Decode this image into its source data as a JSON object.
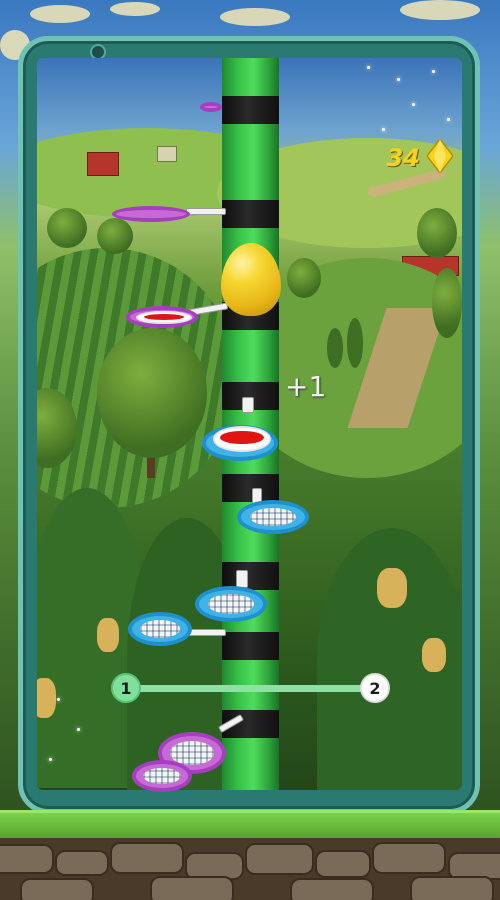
{
  "game": {
    "title": ""
  },
  "hud": {
    "gem_count": "34",
    "gem_icon": "yellow-diamond-gem",
    "score_popup": "+1",
    "level_progress": {
      "current_level": "1",
      "next_level": "2",
      "progress_fraction": 0.95
    }
  },
  "colors": {
    "pole_green": "#38c24a",
    "pole_band": "#111111",
    "platform_purple": "#c86ad6",
    "platform_blue": "#3fb2e8",
    "bounce_pad_red": "#e01412",
    "egg_yellow": "#f6d630",
    "gem_color": "#f7d21e",
    "progress_fill": "#8fe0a4"
  }
}
